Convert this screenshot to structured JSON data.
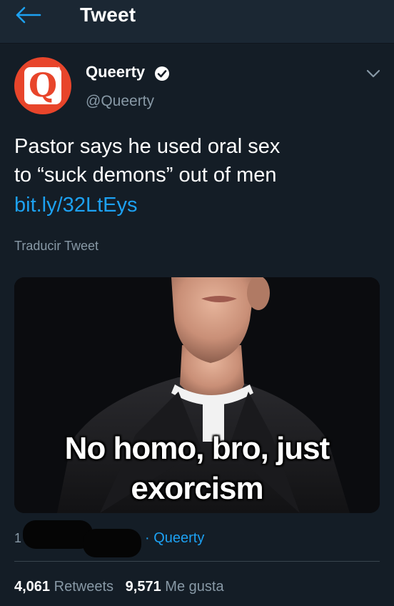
{
  "header": {
    "back_icon": "arrow-left-icon",
    "title": "Tweet"
  },
  "author": {
    "avatar_letter": "Q",
    "avatar_mark": "*",
    "avatar_color": "#e8452b",
    "display_name": "Queerty",
    "verified_icon": "verified-badge-icon",
    "handle": "@Queerty",
    "more_icon": "chevron-down-icon"
  },
  "tweet": {
    "text_line1": "Pastor says he used oral sex",
    "text_line2": "to “suck demons” out of men",
    "link": "bit.ly/32LtEys",
    "translate_label": "Traducir Tweet"
  },
  "media": {
    "caption_line1": "No homo, bro, just",
    "caption_line2": "exorcism"
  },
  "meta": {
    "visible_digit": "1",
    "source": "· Queerty"
  },
  "stats": {
    "retweets_count": "4,061",
    "retweets_label": "Retweets",
    "likes_count": "9,571",
    "likes_label": "Me gusta"
  },
  "colors": {
    "background": "#141d26",
    "header": "#1b2733",
    "link": "#1da1f2",
    "muted": "#8899a6"
  }
}
